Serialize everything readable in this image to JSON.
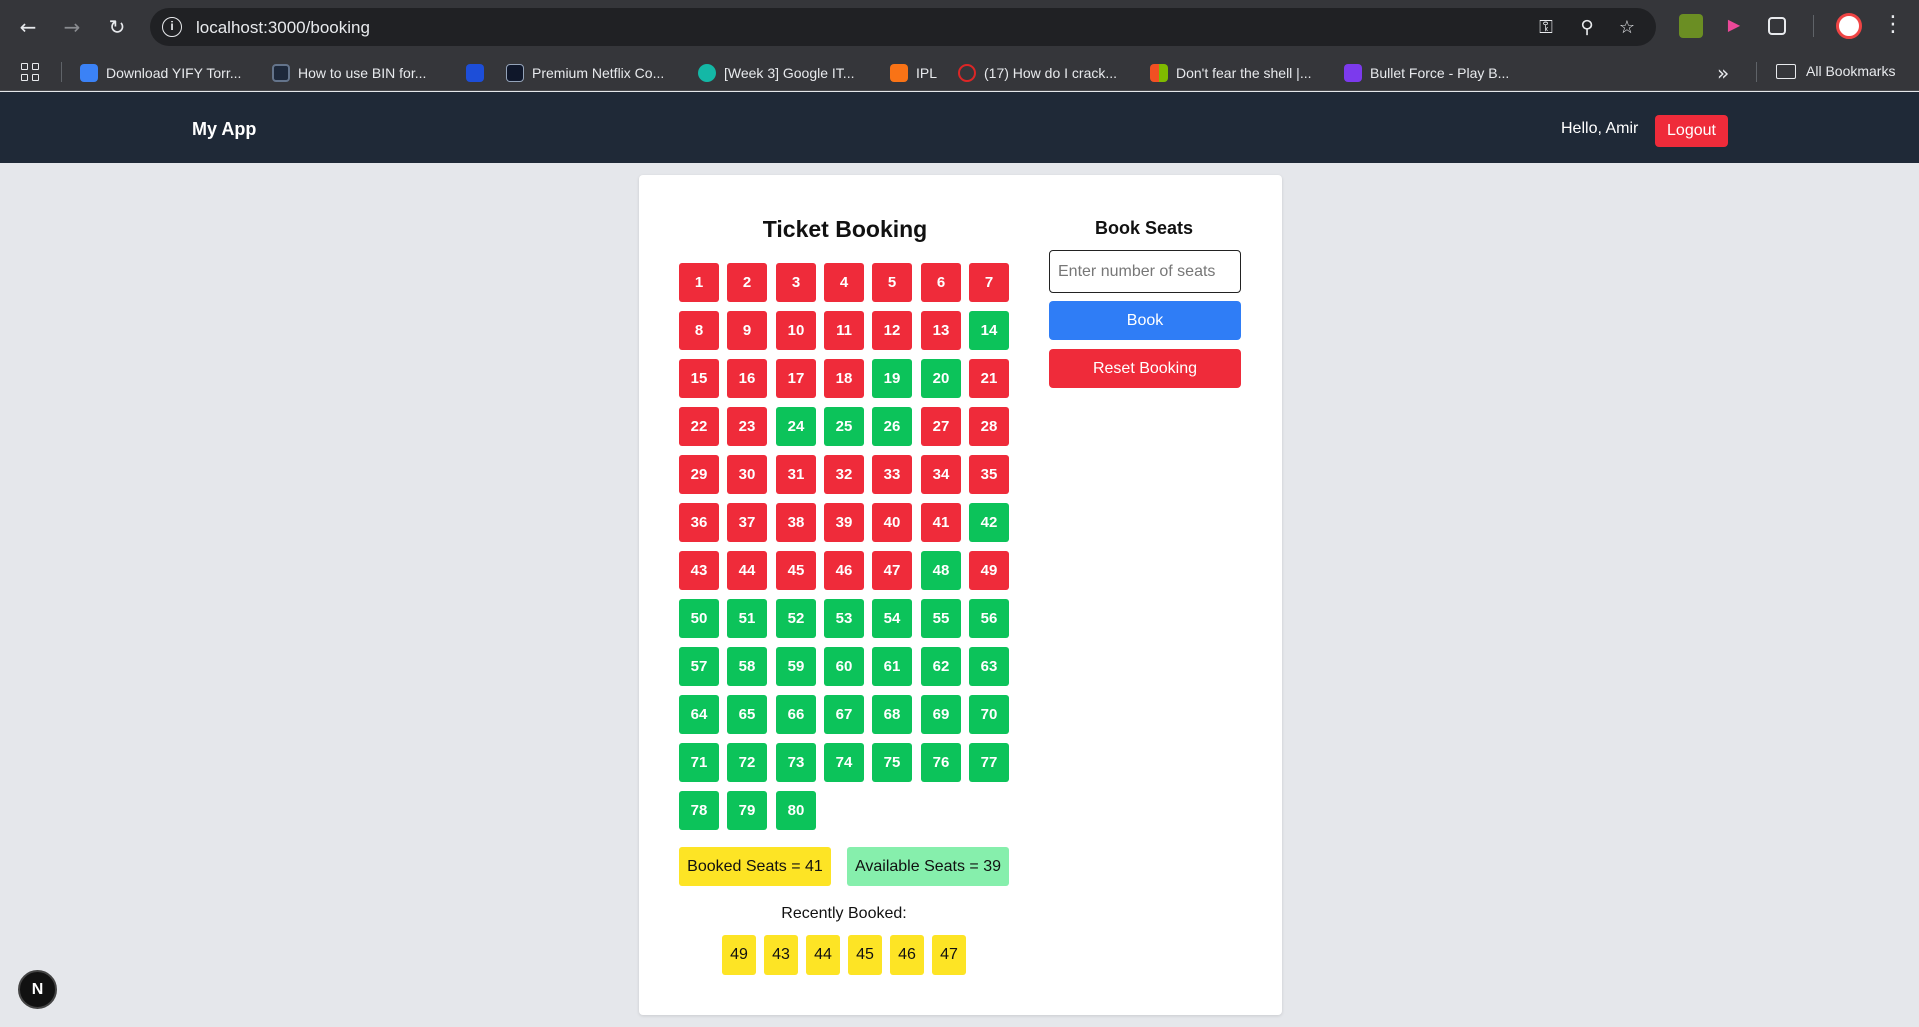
{
  "browser": {
    "url": "localhost:3000/booking",
    "bookmarks": [
      {
        "label": "Download YIFY Torr...",
        "color": "#3b82f6"
      },
      {
        "label": "How to use BIN for...",
        "color": "#1e293b"
      },
      {
        "label": "",
        "color": "#1d4ed8"
      },
      {
        "label": "Premium Netflix Co...",
        "color": "#0f172a"
      },
      {
        "label": "[Week 3] Google IT...",
        "color": "#14b8a6"
      },
      {
        "label": "IPL",
        "color": "#f97316"
      },
      {
        "label": "(17) How do I crack...",
        "color": "#dc2626"
      },
      {
        "label": "Don't fear the shell |...",
        "color": "#22c55e"
      },
      {
        "label": "Bullet Force - Play B...",
        "color": "#7c3aed"
      }
    ],
    "all_bookmarks_label": "All Bookmarks"
  },
  "navbar": {
    "brand": "My App",
    "greeting": "Hello, Amir",
    "logout_label": "Logout"
  },
  "booking": {
    "title": "Ticket Booking",
    "seats": [
      {
        "n": "1",
        "status": "booked"
      },
      {
        "n": "2",
        "status": "booked"
      },
      {
        "n": "3",
        "status": "booked"
      },
      {
        "n": "4",
        "status": "booked"
      },
      {
        "n": "5",
        "status": "booked"
      },
      {
        "n": "6",
        "status": "booked"
      },
      {
        "n": "7",
        "status": "booked"
      },
      {
        "n": "8",
        "status": "booked"
      },
      {
        "n": "9",
        "status": "booked"
      },
      {
        "n": "10",
        "status": "booked"
      },
      {
        "n": "11",
        "status": "booked"
      },
      {
        "n": "12",
        "status": "booked"
      },
      {
        "n": "13",
        "status": "booked"
      },
      {
        "n": "14",
        "status": "available"
      },
      {
        "n": "15",
        "status": "booked"
      },
      {
        "n": "16",
        "status": "booked"
      },
      {
        "n": "17",
        "status": "booked"
      },
      {
        "n": "18",
        "status": "booked"
      },
      {
        "n": "19",
        "status": "available"
      },
      {
        "n": "20",
        "status": "available"
      },
      {
        "n": "21",
        "status": "booked"
      },
      {
        "n": "22",
        "status": "booked"
      },
      {
        "n": "23",
        "status": "booked"
      },
      {
        "n": "24",
        "status": "available"
      },
      {
        "n": "25",
        "status": "available"
      },
      {
        "n": "26",
        "status": "available"
      },
      {
        "n": "27",
        "status": "booked"
      },
      {
        "n": "28",
        "status": "booked"
      },
      {
        "n": "29",
        "status": "booked"
      },
      {
        "n": "30",
        "status": "booked"
      },
      {
        "n": "31",
        "status": "booked"
      },
      {
        "n": "32",
        "status": "booked"
      },
      {
        "n": "33",
        "status": "booked"
      },
      {
        "n": "34",
        "status": "booked"
      },
      {
        "n": "35",
        "status": "booked"
      },
      {
        "n": "36",
        "status": "booked"
      },
      {
        "n": "37",
        "status": "booked"
      },
      {
        "n": "38",
        "status": "booked"
      },
      {
        "n": "39",
        "status": "booked"
      },
      {
        "n": "40",
        "status": "booked"
      },
      {
        "n": "41",
        "status": "booked"
      },
      {
        "n": "42",
        "status": "available"
      },
      {
        "n": "43",
        "status": "booked"
      },
      {
        "n": "44",
        "status": "booked"
      },
      {
        "n": "45",
        "status": "booked"
      },
      {
        "n": "46",
        "status": "booked"
      },
      {
        "n": "47",
        "status": "booked"
      },
      {
        "n": "48",
        "status": "available"
      },
      {
        "n": "49",
        "status": "booked"
      },
      {
        "n": "50",
        "status": "available"
      },
      {
        "n": "51",
        "status": "available"
      },
      {
        "n": "52",
        "status": "available"
      },
      {
        "n": "53",
        "status": "available"
      },
      {
        "n": "54",
        "status": "available"
      },
      {
        "n": "55",
        "status": "available"
      },
      {
        "n": "56",
        "status": "available"
      },
      {
        "n": "57",
        "status": "available"
      },
      {
        "n": "58",
        "status": "available"
      },
      {
        "n": "59",
        "status": "available"
      },
      {
        "n": "60",
        "status": "available"
      },
      {
        "n": "61",
        "status": "available"
      },
      {
        "n": "62",
        "status": "available"
      },
      {
        "n": "63",
        "status": "available"
      },
      {
        "n": "64",
        "status": "available"
      },
      {
        "n": "65",
        "status": "available"
      },
      {
        "n": "66",
        "status": "available"
      },
      {
        "n": "67",
        "status": "available"
      },
      {
        "n": "68",
        "status": "available"
      },
      {
        "n": "69",
        "status": "available"
      },
      {
        "n": "70",
        "status": "available"
      },
      {
        "n": "71",
        "status": "available"
      },
      {
        "n": "72",
        "status": "available"
      },
      {
        "n": "73",
        "status": "available"
      },
      {
        "n": "74",
        "status": "available"
      },
      {
        "n": "75",
        "status": "available"
      },
      {
        "n": "76",
        "status": "available"
      },
      {
        "n": "77",
        "status": "available"
      },
      {
        "n": "78",
        "status": "available"
      },
      {
        "n": "79",
        "status": "available"
      },
      {
        "n": "80",
        "status": "available"
      }
    ],
    "booked_count_label": "Booked Seats = 41",
    "available_count_label": "Available Seats = 39",
    "recently_booked_label": "Recently Booked:",
    "recently_booked": [
      "49",
      "43",
      "44",
      "45",
      "46",
      "47"
    ]
  },
  "panel": {
    "title": "Book Seats",
    "input_placeholder": "Enter number of seats",
    "input_value": "",
    "book_label": "Book",
    "reset_label": "Reset Booking"
  },
  "dev_badge": "N",
  "colors": {
    "booked": "#ef2b3a",
    "available": "#0cc35a",
    "highlight": "#fde425",
    "primary": "#2f7df6",
    "navbar": "#1f2937"
  }
}
